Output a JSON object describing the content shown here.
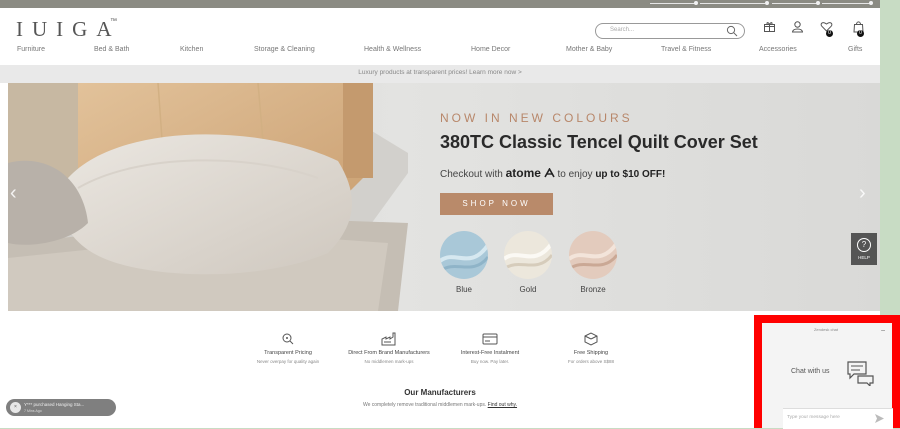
{
  "header": {
    "logo": "IUIGA",
    "trademark": "™",
    "search_placeholder": "Search...",
    "wishlist_count": "0",
    "cart_count": "0"
  },
  "nav": {
    "items": [
      "Furniture",
      "Bed & Bath",
      "Kitchen",
      "Storage & Cleaning",
      "Health & Wellness",
      "Home Decor",
      "Mother & Baby",
      "Travel & Fitness",
      "Accessories",
      "Gifts"
    ]
  },
  "promo": {
    "text": "Luxury products at transparent prices! Learn more now >"
  },
  "hero": {
    "eyebrow": "NOW IN NEW COLOURS",
    "title": "380TC Classic Tencel Quilt Cover Set",
    "checkout_pre": "Checkout with",
    "atome": "atome",
    "checkout_mid": "to enjoy",
    "checkout_bold": "up to $10 OFF!",
    "cta": "SHOP NOW",
    "swatches": [
      {
        "label": "Blue",
        "color": "#a9c8d8"
      },
      {
        "label": "Gold",
        "color": "#ece7dc"
      },
      {
        "label": "Bronze",
        "color": "#e3cbbd"
      }
    ]
  },
  "help": {
    "label": "HELP"
  },
  "features": [
    {
      "title": "Transparent Pricing",
      "sub": "Never overpay for quality again"
    },
    {
      "title": "Direct From Brand Manufacturers",
      "sub": "No middlemen mark-ups"
    },
    {
      "title": "Interest-Free Instalment",
      "sub": "Buy now. Pay later."
    },
    {
      "title": "Free Shipping",
      "sub": "For orders above S$88"
    }
  ],
  "manufacturers": {
    "title": "Our Manufacturers",
    "sub": "We completely remove traditional middlemen mark-ups.",
    "link": "Find out why."
  },
  "toast": {
    "text": "Y*** purchased Hanging Sta...",
    "time": "7 Mins Ago"
  },
  "chat": {
    "header": "Zendesk chat",
    "prompt": "Chat with us",
    "input_placeholder": "Type your message here"
  },
  "colors": {
    "accent": "#b98a6a",
    "highlight": "#ff0000",
    "outside": "#c8dcc4"
  }
}
